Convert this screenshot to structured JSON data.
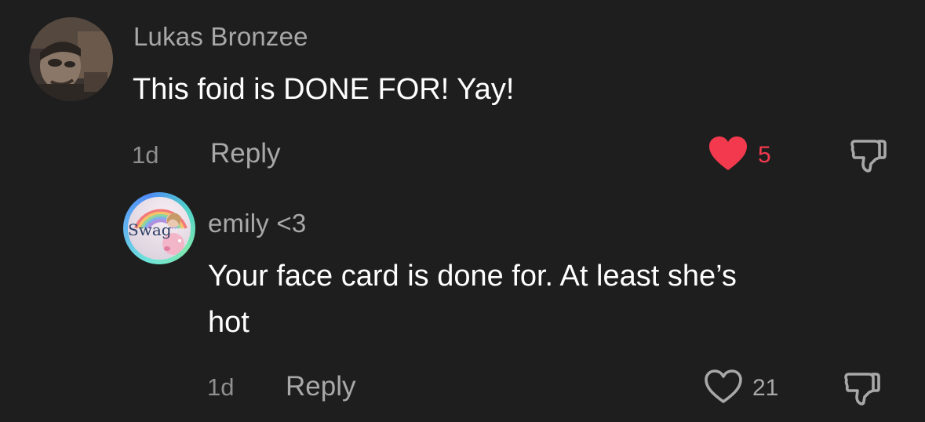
{
  "thread": {
    "comment": {
      "username": "Lukas Bronzee",
      "text": "This foid is DONE FOR! Yay!",
      "time": "1d",
      "reply_label": "Reply",
      "likes": "5",
      "liked": true,
      "like_color": "#f3394d"
    },
    "reply": {
      "username": "emily <3",
      "text_line1": "Your face card is done for. At least she’s",
      "text_line2": "hot",
      "avatar_text": "Swag",
      "time": "1d",
      "reply_label": "Reply",
      "likes": "21",
      "liked": false
    }
  },
  "icons": {
    "like_filled": "heart-filled-icon",
    "like_outline": "heart-outline-icon",
    "dislike": "thumbs-down-icon"
  }
}
